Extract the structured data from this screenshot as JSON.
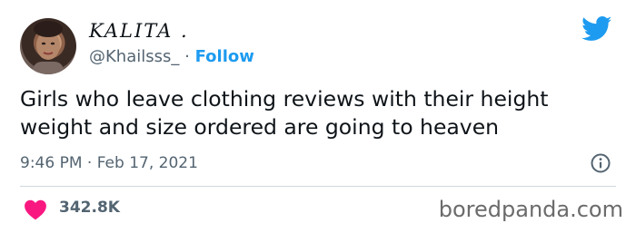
{
  "user": {
    "display_name": "KALITA .",
    "handle": "@Khailsss_",
    "separator": "·",
    "follow_label": "Follow"
  },
  "tweet": {
    "text": "Girls who leave clothing reviews with their height weight and size ordered are going to heaven",
    "timestamp": "9:46 PM · Feb 17, 2021"
  },
  "stats": {
    "likes": "342.8K"
  },
  "watermark": "boredpanda.com",
  "icons": [
    "twitter-bird-icon",
    "info-icon",
    "heart-icon"
  ],
  "colors": {
    "accent": "#1d9bf0",
    "heart": "#f91880",
    "muted": "#536471",
    "text": "#0f1419"
  }
}
